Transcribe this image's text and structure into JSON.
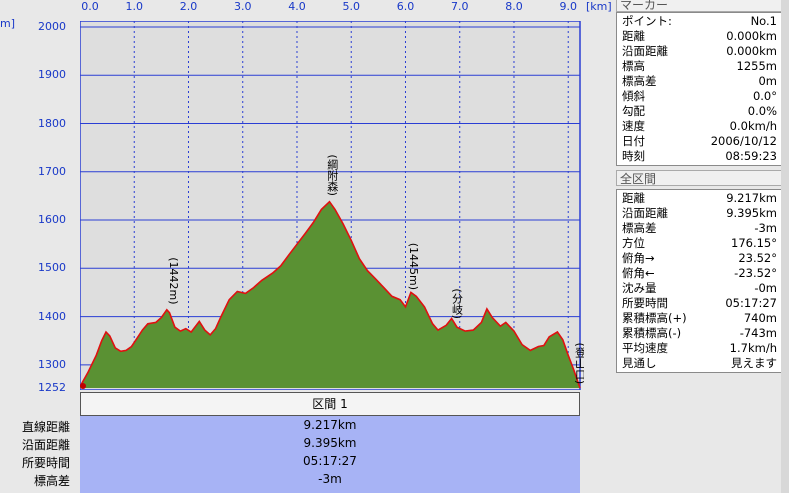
{
  "chart_data": {
    "type": "area",
    "xlabel": "",
    "x_unit": "[km]",
    "y_unit": "m]",
    "xlim": [
      0,
      9.217
    ],
    "ylim": [
      1252,
      2000
    ],
    "xticks": [
      "0.0",
      "1.0",
      "2.0",
      "3.0",
      "4.0",
      "5.0",
      "6.0",
      "7.0",
      "8.0",
      "9.0"
    ],
    "yticks": [
      "2000",
      "1900",
      "1800",
      "1700",
      "1600",
      "1500",
      "1400",
      "1300"
    ],
    "ymin_label": "1252",
    "grid": true,
    "colors": {
      "fill": "#5a9133",
      "line": "#e01010",
      "grid": "#2a3ed4",
      "plot_bg": "#dedede"
    },
    "profile": [
      [
        0.0,
        1255
      ],
      [
        0.15,
        1285
      ],
      [
        0.3,
        1320
      ],
      [
        0.4,
        1350
      ],
      [
        0.48,
        1368
      ],
      [
        0.55,
        1360
      ],
      [
        0.65,
        1335
      ],
      [
        0.75,
        1328
      ],
      [
        0.85,
        1330
      ],
      [
        0.95,
        1338
      ],
      [
        1.05,
        1355
      ],
      [
        1.15,
        1372
      ],
      [
        1.25,
        1385
      ],
      [
        1.4,
        1388
      ],
      [
        1.5,
        1398
      ],
      [
        1.6,
        1414
      ],
      [
        1.65,
        1408
      ],
      [
        1.75,
        1378
      ],
      [
        1.85,
        1370
      ],
      [
        1.95,
        1375
      ],
      [
        2.05,
        1368
      ],
      [
        2.2,
        1390
      ],
      [
        2.3,
        1372
      ],
      [
        2.4,
        1362
      ],
      [
        2.5,
        1375
      ],
      [
        2.6,
        1400
      ],
      [
        2.75,
        1435
      ],
      [
        2.9,
        1452
      ],
      [
        3.05,
        1448
      ],
      [
        3.2,
        1460
      ],
      [
        3.35,
        1475
      ],
      [
        3.55,
        1490
      ],
      [
        3.7,
        1505
      ],
      [
        3.85,
        1528
      ],
      [
        4.0,
        1550
      ],
      [
        4.15,
        1572
      ],
      [
        4.3,
        1595
      ],
      [
        4.45,
        1622
      ],
      [
        4.6,
        1638
      ],
      [
        4.7,
        1622
      ],
      [
        4.85,
        1592
      ],
      [
        5.0,
        1558
      ],
      [
        5.15,
        1520
      ],
      [
        5.3,
        1495
      ],
      [
        5.45,
        1478
      ],
      [
        5.6,
        1460
      ],
      [
        5.75,
        1442
      ],
      [
        5.9,
        1435
      ],
      [
        6.0,
        1420
      ],
      [
        6.1,
        1450
      ],
      [
        6.2,
        1442
      ],
      [
        6.35,
        1420
      ],
      [
        6.5,
        1385
      ],
      [
        6.6,
        1372
      ],
      [
        6.75,
        1382
      ],
      [
        6.85,
        1396
      ],
      [
        6.95,
        1378
      ],
      [
        7.1,
        1370
      ],
      [
        7.25,
        1372
      ],
      [
        7.4,
        1388
      ],
      [
        7.5,
        1416
      ],
      [
        7.6,
        1398
      ],
      [
        7.75,
        1380
      ],
      [
        7.85,
        1388
      ],
      [
        8.0,
        1370
      ],
      [
        8.15,
        1342
      ],
      [
        8.3,
        1330
      ],
      [
        8.45,
        1338
      ],
      [
        8.55,
        1340
      ],
      [
        8.65,
        1358
      ],
      [
        8.8,
        1368
      ],
      [
        8.9,
        1352
      ],
      [
        9.0,
        1320
      ],
      [
        9.1,
        1290
      ],
      [
        9.217,
        1252
      ]
    ],
    "annotations": [
      {
        "label": "(綱附森)",
        "x": 4.65,
        "y": 1650
      },
      {
        "label": "(1442m)",
        "x": 1.72,
        "y": 1425
      },
      {
        "label": "(1445m)",
        "x": 6.15,
        "y": 1455
      },
      {
        "label": "(分岐)",
        "x": 6.95,
        "y": 1395
      },
      {
        "label": "(登山口)",
        "x": 9.217,
        "y": 1260
      }
    ]
  },
  "section": {
    "header": "区間 1",
    "labels": [
      "直線距離",
      "沿面距離",
      "所要時間",
      "標高差"
    ],
    "values": [
      "9.217km",
      "9.395km",
      "05:17:27",
      "-3m"
    ]
  },
  "marker": {
    "title": "マーカー",
    "rows": [
      {
        "label": "ポイント:",
        "value": "No.1"
      },
      {
        "label": "距離",
        "value": "0.000km"
      },
      {
        "label": "沿面距離",
        "value": "0.000km"
      },
      {
        "label": "標高",
        "value": "1255m"
      },
      {
        "label": "標高差",
        "value": "0m"
      },
      {
        "label": "傾斜",
        "value": "0.0°"
      },
      {
        "label": "勾配",
        "value": "0.0%"
      },
      {
        "label": "速度",
        "value": "0.0km/h"
      },
      {
        "label": "日付",
        "value": "2006/10/12"
      },
      {
        "label": "時刻",
        "value": "08:59:23"
      }
    ]
  },
  "total": {
    "title": "全区間",
    "rows": [
      {
        "label": "距離",
        "value": "9.217km"
      },
      {
        "label": "沿面距離",
        "value": "9.395km"
      },
      {
        "label": "標高差",
        "value": "-3m"
      },
      {
        "label": "方位",
        "value": "176.15°"
      },
      {
        "label": "俯角→",
        "value": "23.52°"
      },
      {
        "label": "俯角←",
        "value": "-23.52°"
      },
      {
        "label": "沈み量",
        "value": "-0m"
      },
      {
        "label": "所要時間",
        "value": "05:17:27"
      },
      {
        "label": "累積標高(+)",
        "value": "740m"
      },
      {
        "label": "累積標高(-)",
        "value": "-743m"
      },
      {
        "label": "平均速度",
        "value": "1.7km/h"
      },
      {
        "label": "見通し",
        "value": "見えます"
      }
    ]
  }
}
